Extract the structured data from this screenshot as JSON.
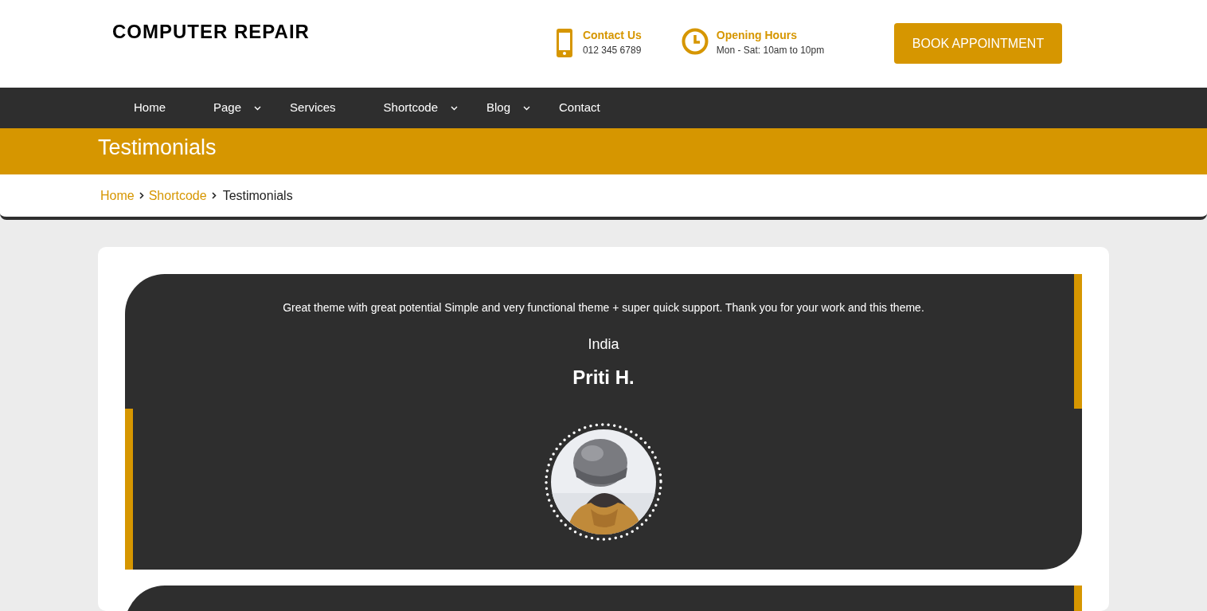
{
  "header": {
    "logo": "COMPUTER REPAIR",
    "contact": {
      "title": "Contact Us",
      "value": "012 345 6789"
    },
    "hours": {
      "title": "Opening Hours",
      "value": "Mon - Sat: 10am to 10pm"
    },
    "button": "BOOK APPOINTMENT"
  },
  "nav": [
    {
      "label": "Home",
      "has_dropdown": false
    },
    {
      "label": "Page",
      "has_dropdown": true
    },
    {
      "label": "Services",
      "has_dropdown": false
    },
    {
      "label": "Shortcode",
      "has_dropdown": true
    },
    {
      "label": "Blog",
      "has_dropdown": true
    },
    {
      "label": "Contact",
      "has_dropdown": false
    }
  ],
  "page_title": "Testimonials",
  "breadcrumb": [
    {
      "label": "Home",
      "kind": "link"
    },
    {
      "label": "Shortcode",
      "kind": "link"
    },
    {
      "label": "Testimonials",
      "kind": "current"
    }
  ],
  "testimonials": [
    {
      "quote": "Great theme with great potential Simple and very functional theme + super quick support. Thank you for your work and this theme.",
      "location": "India",
      "name": "Priti H."
    }
  ]
}
